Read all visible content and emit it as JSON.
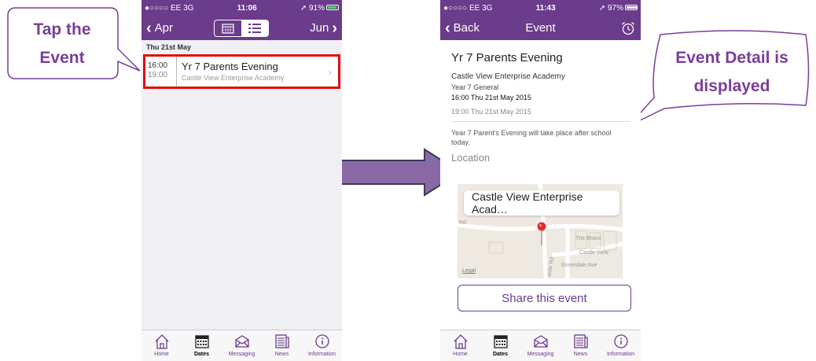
{
  "callouts": {
    "tap": [
      "Tap the",
      "Event"
    ],
    "detail": [
      "Event Detail is",
      "displayed"
    ]
  },
  "left_phone": {
    "status": {
      "carrier": "●○○○○ EE  3G",
      "time": "11:06",
      "battery": "91%"
    },
    "nav": {
      "prev": "Apr",
      "next": "Jun"
    },
    "day_header": "Thu  21st May",
    "event": {
      "start": "16:00",
      "end": "19:00",
      "title": "Yr 7 Parents Evening",
      "school": "Castle View Enterprise Academy"
    }
  },
  "right_phone": {
    "status": {
      "carrier": "●○○○○ EE  3G",
      "time": "11:43",
      "battery": "97%"
    },
    "nav": {
      "back": "Back",
      "title": "Event"
    },
    "detail": {
      "title": "Yr 7 Parents Evening",
      "school": "Castle View Enterprise Academy",
      "group": "Year 7 General",
      "start": "16:00 Thu 21st May 2015",
      "end": "19:00 Thu 21st May 2015",
      "description": "Year 7 Parent's Evening will take place after school today.",
      "location_label": "Location"
    },
    "map": {
      "bubble": "Castle View Enterprise Acad…",
      "labels": [
        "The Briars",
        "Castle View",
        "Ennerdale Ave",
        "Rd",
        "astle Rd"
      ],
      "legal": "Legal"
    },
    "share": "Share this event"
  },
  "tabs": [
    "Home",
    "Dates",
    "Messaging",
    "News",
    "Information"
  ],
  "colors": {
    "brand": "#6b3b8c",
    "highlight": "#e01010",
    "callout_text": "#7a3f99"
  }
}
